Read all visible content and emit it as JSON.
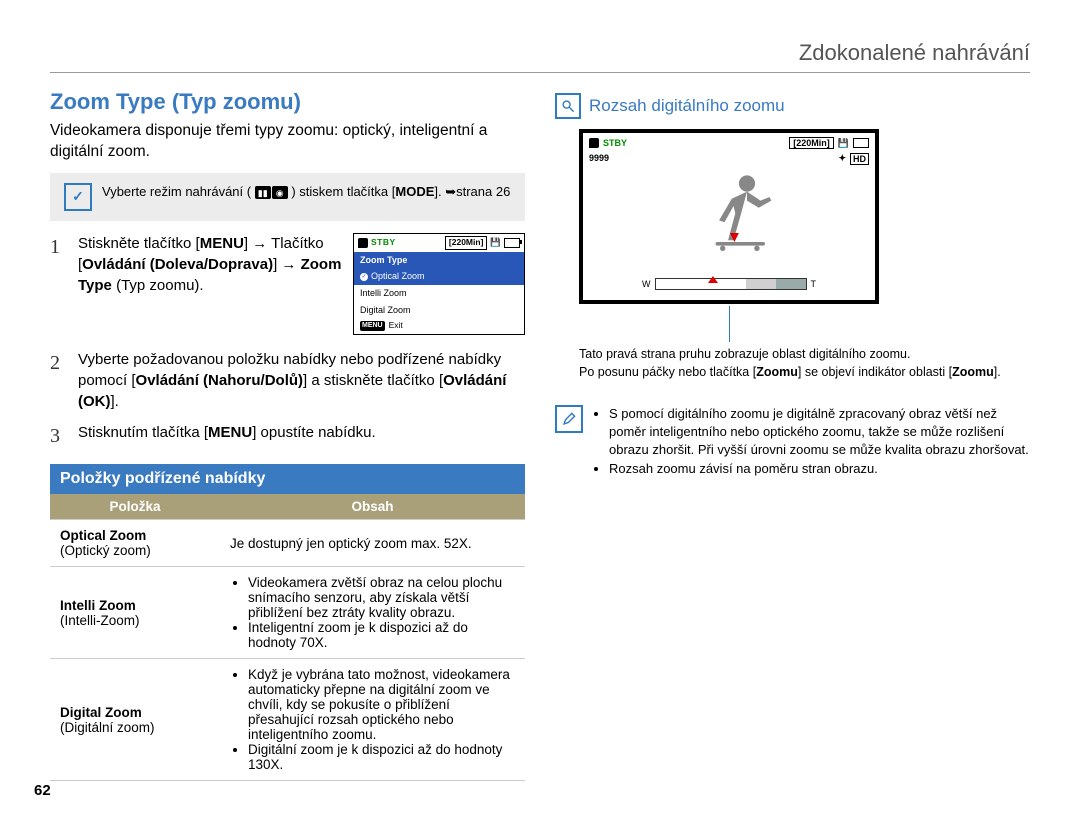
{
  "chapter": "Zdokonalené nahrávání",
  "pageNumber": "62",
  "left": {
    "title": "Zoom Type (Typ zoomu)",
    "intro": "Videokamera disponuje třemi typy zoomu: optický, inteligentní a digitální zoom.",
    "note": {
      "pre": "Vyberte režim nahrávání (",
      "post": ") stiskem tlačítka [",
      "mode": "MODE",
      "tail": "]. ➥strana 26"
    },
    "steps": {
      "s1_a": "Stiskněte tlačítko [",
      "s1_menu": "MENU",
      "s1_b": "] → Tlačítko [",
      "s1_ctrl": "Ovládání (Doleva/Doprava)",
      "s1_c": "] → ",
      "s1_zoom": "Zoom Type",
      "s1_d": " (Typ zoomu).",
      "s2_a": "Vyberte požadovanou položku nabídky nebo podřízené nabídky pomocí [",
      "s2_b": "Ovládání (Nahoru/Dolů)",
      "s2_c": "] a stiskněte tlačítko [",
      "s2_ok": "Ovládání (OK)",
      "s2_d": "].",
      "s3_a": "Stisknutím tlačítka [",
      "s3_menu": "MENU",
      "s3_b": "] opustíte nabídku."
    },
    "lcd": {
      "stby": "STBY",
      "time": "[220Min]",
      "menuHead": "Zoom Type",
      "opt": "Optical Zoom",
      "intelli": "Intelli Zoom",
      "digi": "Digital Zoom",
      "exit": "Exit",
      "menuBtn": "MENU"
    },
    "subheader": "Položky podřízené nabídky",
    "table": {
      "thItem": "Položka",
      "thContent": "Obsah",
      "r1name": "Optical Zoom",
      "r1sub": "(Optický zoom)",
      "r1text": "Je dostupný jen optický zoom max. 52X.",
      "r2name": "Intelli Zoom",
      "r2sub": "(Intelli-Zoom)",
      "r2b1": "Videokamera zvětší obraz na celou plochu snímacího senzoru, aby získala větší přiblížení bez ztráty kvality obrazu.",
      "r2b2": "Inteligentní zoom je k dispozici až do hodnoty 70X.",
      "r3name": "Digital Zoom",
      "r3sub": "(Digitální zoom)",
      "r3b1": "Když je vybrána tato možnost, videokamera automaticky přepne na digitální zoom ve chvíli, kdy se pokusíte o přiblížení přesahující rozsah optického nebo inteligentního zoomu.",
      "r3b2": "Digitální zoom je k dispozici až do hodnoty 130X."
    }
  },
  "right": {
    "title": "Rozsah digitálního zoomu",
    "hud": {
      "stby": "STBY",
      "time": "[220Min]",
      "count9": "9999",
      "hd": "HD"
    },
    "zoom": {
      "w": "W",
      "t": "T"
    },
    "caption_a": "Tato pravá strana pruhu zobrazuje oblast digitálního zoomu.",
    "caption_b": "Po posunu páčky nebo tlačítka [",
    "caption_zoom": "Zoomu",
    "caption_c": "] se objeví indikátor oblasti [",
    "caption_zoom2": "Zoomu",
    "caption_d": "].",
    "tip1": "S pomocí digitálního zoomu je digitálně zpracovaný obraz větší než poměr inteligentního nebo optického zoomu, takže se může rozlišení obrazu zhoršit. Při vyšší úrovni zoomu se může kvalita obrazu zhoršovat.",
    "tip2": "Rozsah zoomu závisí na poměru stran obrazu."
  }
}
